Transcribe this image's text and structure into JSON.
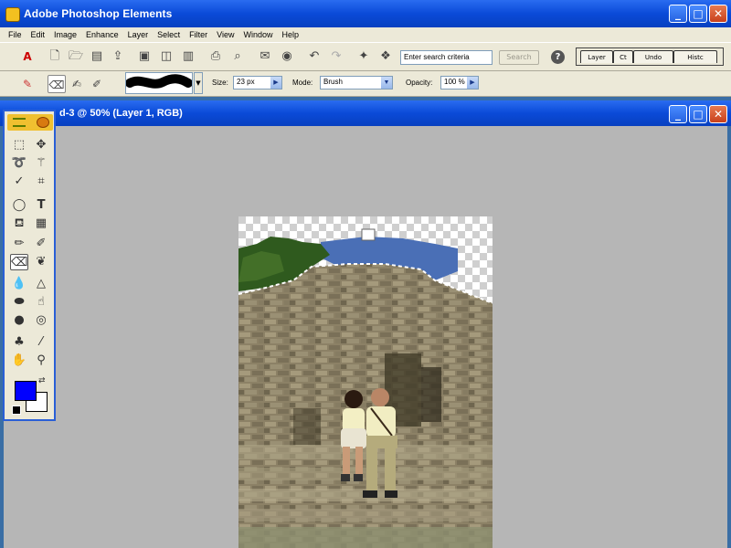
{
  "app": {
    "title": "Adobe Photoshop Elements"
  },
  "window_controls": {
    "minimize": "_",
    "maximize": "□",
    "close": "✕"
  },
  "menu": [
    "File",
    "Edit",
    "Image",
    "Enhance",
    "Layer",
    "Select",
    "Filter",
    "View",
    "Window",
    "Help"
  ],
  "shortcuts": {
    "search_placeholder": "Enter search criteria",
    "search_button": "Search",
    "help_icon": "?",
    "palette_tabs": [
      "Layer",
      "Ct",
      "Undo",
      "Histc"
    ]
  },
  "options": {
    "size_label": "Size:",
    "size_value": "23 px",
    "mode_label": "Mode:",
    "mode_value": "Brush",
    "opacity_label": "Opacity:",
    "opacity_value": "100 %"
  },
  "document": {
    "title": "d-3 @ 50% (Layer 1, RGB)"
  },
  "toolbox": {
    "foreground_color": "#0000ff",
    "background_color": "#ffffff"
  },
  "colors": {
    "titlebar": "#0a4ad8",
    "chrome": "#ece9d8",
    "canvas": "#b6b6b6"
  }
}
